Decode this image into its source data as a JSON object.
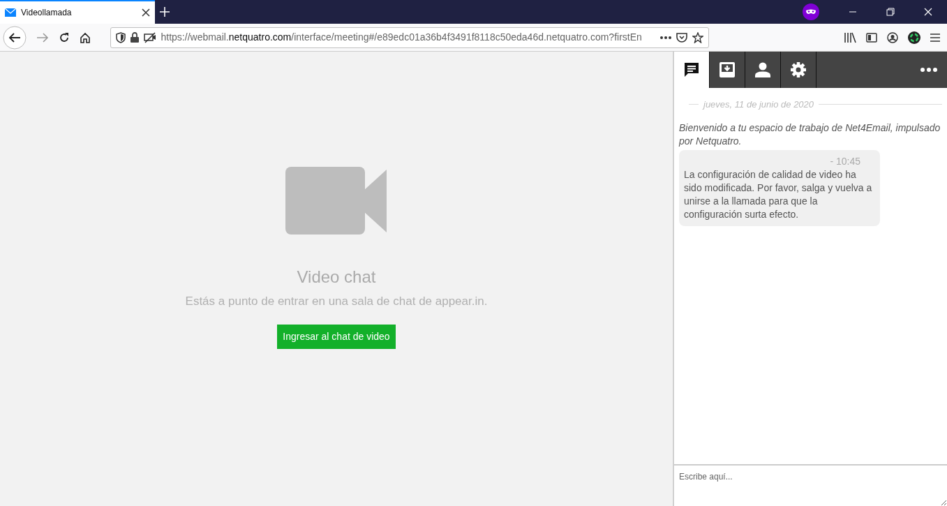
{
  "browser": {
    "tab": {
      "title": "Videollamada",
      "selected": true
    },
    "url": {
      "prefix": "https://webmail.",
      "domain": "netquatro.com",
      "rest": "/interface/meeting#/e89edc01a36b4f3491f8118c50eda46d.netquatro.com?firstEn"
    }
  },
  "main": {
    "title": "Video chat",
    "subtitle": "Estás a punto de entrar en una sala de chat de appear.in.",
    "button": "Ingresar al chat de video"
  },
  "side_tabs": [
    {
      "kind": "chat",
      "selected": true
    },
    {
      "kind": "inbox",
      "selected": false
    },
    {
      "kind": "contact",
      "selected": false
    },
    {
      "kind": "settings",
      "selected": false
    }
  ],
  "chat": {
    "date": "jueves, 11 de junio de 2020",
    "welcome": "Bienvenido a tu espacio de trabajo de Net4Email, impulsado por Netquatro.",
    "messages": [
      {
        "time": "- 10:45",
        "text": "La configuración de calidad de video ha sido modificada. Por favor, salga y vuelva a unirse a la llamada para que la configuración surta efecto."
      }
    ],
    "input": {
      "placeholder": "Escribe aquí..."
    }
  }
}
